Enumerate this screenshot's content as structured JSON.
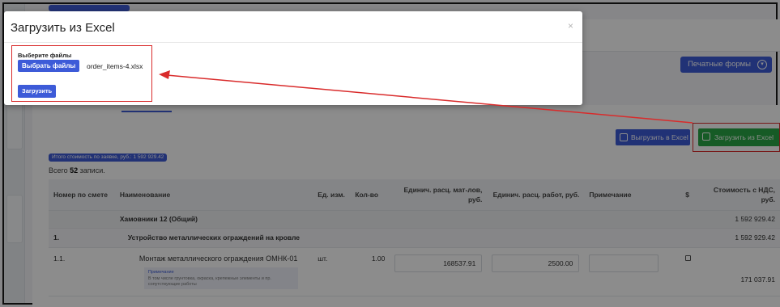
{
  "toolbar": {
    "print_forms_label": "Печатные формы",
    "export_excel_label": "Выгрузить в Excel",
    "import_excel_label": "Загрузить из Excel"
  },
  "summary": {
    "total_badge": "Итого стоимость по заявке, руб.: 1 592 929.42",
    "records_prefix": "Всего",
    "records_count": "52",
    "records_suffix": "записи."
  },
  "table": {
    "columns": [
      "Номер по смете",
      "Наименование",
      "Ед. изм.",
      "Кол-во",
      "Единич. расц. мат-лов, руб.",
      "Единич. расц. работ, руб.",
      "Примечание",
      "$",
      "Стоимость с НДС, руб."
    ],
    "group_row": {
      "name": "Хамовники 12 (Общий)",
      "total": "1 592 929.42"
    },
    "section_row": {
      "number": "1.",
      "name": "Устройство металлических ограждений на кровле",
      "total": "1 592 929.42"
    },
    "item_row": {
      "number": "1.1.",
      "name": "Монтаж металлического ограждения ОМНК-01",
      "unit": "шт.",
      "qty": "1.00",
      "mat_price": "168537.91",
      "work_price": "2500.00",
      "note": "",
      "total": "171 037.91",
      "note_title": "Примечание",
      "note_text": "В том числе грунтовка, окраска, крепежные элементы и пр. сопутствующие работы"
    }
  },
  "modal": {
    "title": "Загрузить из Excel",
    "close_symbol": "×",
    "choose_label": "Выберите файлы",
    "choose_button": "Выбрать файлы",
    "file_name": "order_items-4.xlsx",
    "upload_button": "Загрузить"
  },
  "colors": {
    "accent": "#3d5bd8",
    "import_green": "#28a745",
    "highlight_red": "#d92b2b"
  }
}
